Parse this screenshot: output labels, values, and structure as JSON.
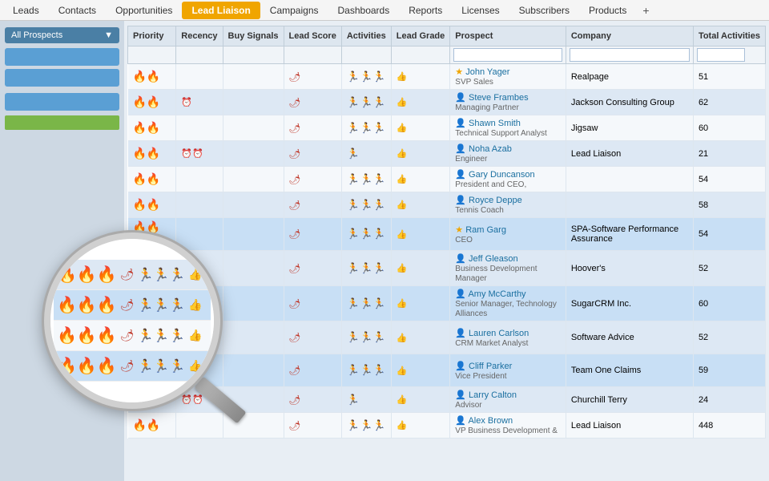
{
  "nav": {
    "items": [
      {
        "label": "Leads",
        "active": false
      },
      {
        "label": "Contacts",
        "active": false
      },
      {
        "label": "Opportunities",
        "active": false
      },
      {
        "label": "Lead Liaison",
        "active": true
      },
      {
        "label": "Campaigns",
        "active": false
      },
      {
        "label": "Dashboards",
        "active": false
      },
      {
        "label": "Reports",
        "active": false
      },
      {
        "label": "Licenses",
        "active": false
      },
      {
        "label": "Subscribers",
        "active": false
      },
      {
        "label": "Products",
        "active": false
      }
    ],
    "plus_label": "+"
  },
  "sidebar": {
    "dropdown_label": "▼",
    "buttons": [
      "",
      "",
      "",
      ""
    ]
  },
  "table": {
    "columns": [
      "Priority",
      "Recency",
      "Buy Signals",
      "Lead Score",
      "Activities",
      "Lead Grade",
      "Prospect",
      "Company",
      "Total Activities"
    ],
    "filter_placeholders": [
      "",
      "",
      "",
      "",
      "",
      "",
      "",
      "",
      ""
    ],
    "rows": [
      {
        "priority": "🔥🔥",
        "recency": "",
        "buy_signals": "",
        "lead_score": "🌶",
        "activities": "🏃🏃🏃",
        "lead_grade": "👍",
        "prospect_name": "John Yager",
        "prospect_title": "SVP Sales",
        "prospect_icon": "star",
        "company": "Realpage",
        "total": "51",
        "highlight": false
      },
      {
        "priority": "🔥🔥",
        "recency": "⏰",
        "buy_signals": "",
        "lead_score": "🌶",
        "activities": "🏃🏃🏃",
        "lead_grade": "👍",
        "prospect_name": "Steve Frambes",
        "prospect_title": "Managing Partner",
        "prospect_icon": "user",
        "company": "Jackson Consulting Group",
        "total": "62",
        "highlight": false
      },
      {
        "priority": "🔥🔥",
        "recency": "",
        "buy_signals": "",
        "lead_score": "🌶",
        "activities": "🏃🏃🏃",
        "lead_grade": "👍",
        "prospect_name": "Shawn Smith",
        "prospect_title": "Technical Support Analyst",
        "prospect_icon": "user",
        "company": "Jigsaw",
        "total": "60",
        "highlight": false
      },
      {
        "priority": "🔥🔥",
        "recency": "⏰⏰",
        "buy_signals": "",
        "lead_score": "🌶",
        "activities": "🏃",
        "lead_grade": "👍",
        "prospect_name": "Noha Azab",
        "prospect_title": "Engineer",
        "prospect_icon": "user",
        "company": "Lead Liaison",
        "total": "21",
        "highlight": false
      },
      {
        "priority": "🔥🔥",
        "recency": "",
        "buy_signals": "",
        "lead_score": "🌶",
        "activities": "🏃🏃🏃",
        "lead_grade": "👍",
        "prospect_name": "Gary Duncanson",
        "prospect_title": "President and CEO,",
        "prospect_icon": "user",
        "company": "",
        "total": "54",
        "highlight": false
      },
      {
        "priority": "🔥🔥",
        "recency": "",
        "buy_signals": "",
        "lead_score": "🌶",
        "activities": "🏃🏃🏃",
        "lead_grade": "👍",
        "prospect_name": "Royce Deppe",
        "prospect_title": "Tennis Coach",
        "prospect_icon": "user",
        "company": "",
        "total": "58",
        "highlight": false
      },
      {
        "priority": "🔥🔥🔥",
        "recency": "",
        "buy_signals": "",
        "lead_score": "🌶",
        "activities": "🏃🏃🏃",
        "lead_grade": "👍",
        "prospect_name": "Ram Garg",
        "prospect_title": "CEO",
        "prospect_icon": "star",
        "company": "SPA-Software Performance Assurance",
        "total": "54",
        "highlight": true
      },
      {
        "priority": "🔥🔥🔥",
        "recency": "",
        "buy_signals": "",
        "lead_score": "🌶",
        "activities": "🏃🏃🏃",
        "lead_grade": "👍",
        "prospect_name": "Jeff Gleason",
        "prospect_title": "Business Development Manager",
        "prospect_icon": "user",
        "company": "Hoover's",
        "total": "52",
        "highlight": false
      },
      {
        "priority": "🔥🔥🔥",
        "recency": "",
        "buy_signals": "",
        "lead_score": "🌶",
        "activities": "🏃🏃🏃",
        "lead_grade": "👍",
        "prospect_name": "Amy McCarthy",
        "prospect_title": "Senior Manager, Technology Alliances",
        "prospect_icon": "user",
        "company": "SugarCRM Inc.",
        "total": "60",
        "highlight": true
      },
      {
        "priority": "🔥🔥🔥",
        "recency": "",
        "buy_signals": "",
        "lead_score": "🌶",
        "activities": "🏃🏃🏃",
        "lead_grade": "👍",
        "prospect_name": "Lauren Carlson",
        "prospect_title": "CRM Market Analyst",
        "prospect_icon": "user",
        "company": "Software Advice",
        "total": "52",
        "highlight": false
      },
      {
        "priority": "🔥🔥🔥",
        "recency": "",
        "buy_signals": "",
        "lead_score": "🌶",
        "activities": "🏃🏃🏃",
        "lead_grade": "👍",
        "prospect_name": "Cliff Parker",
        "prospect_title": "Vice President",
        "prospect_icon": "user",
        "company": "Team One Claims",
        "total": "59",
        "highlight": true
      },
      {
        "priority": "🔥🔥",
        "recency": "⏰⏰",
        "buy_signals": "",
        "lead_score": "🌶",
        "activities": "🏃",
        "lead_grade": "👍",
        "prospect_name": "Larry Calton",
        "prospect_title": "Advisor",
        "prospect_icon": "user",
        "company": "Churchill Terry",
        "total": "24",
        "highlight": false
      },
      {
        "priority": "🔥🔥",
        "recency": "",
        "buy_signals": "",
        "lead_score": "🌶",
        "activities": "🏃🏃🏃",
        "lead_grade": "👍",
        "prospect_name": "Alex Brown",
        "prospect_title": "VP Business Development &",
        "prospect_icon": "user",
        "company": "Lead Liaison",
        "total": "448",
        "highlight": false
      }
    ]
  }
}
